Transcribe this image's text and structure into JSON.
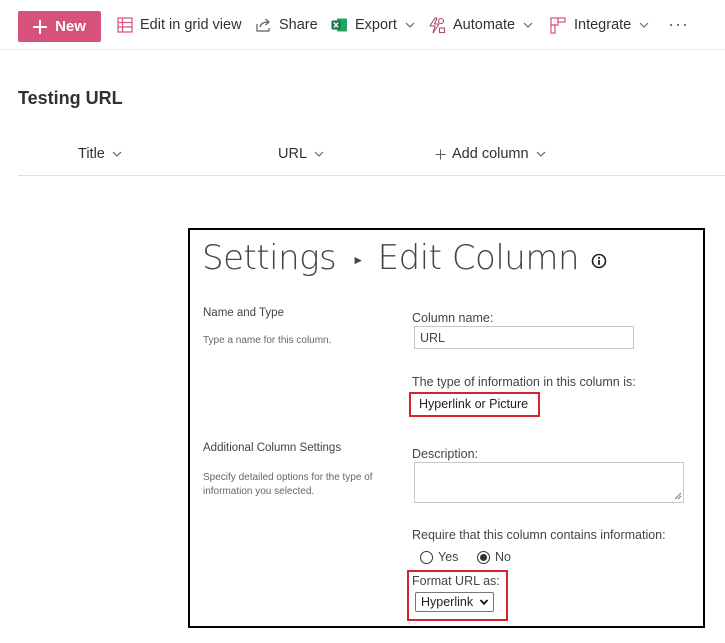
{
  "command_bar": {
    "new_label": "New",
    "edit_grid_label": "Edit in grid view",
    "share_label": "Share",
    "export_label": "Export",
    "automate_label": "Automate",
    "integrate_label": "Integrate",
    "more_label": "···"
  },
  "list": {
    "title": "Testing URL",
    "columns": [
      "Title",
      "URL"
    ],
    "add_column_label": "Add column"
  },
  "settings": {
    "breadcrumb_root": "Settings",
    "breadcrumb_page": "Edit Column",
    "name_type_section": {
      "title": "Name and Type",
      "description": "Type a name for this column."
    },
    "column_name_label": "Column name:",
    "column_name_value": "URL",
    "type_label": "The type of information in this column is:",
    "type_value": "Hyperlink or Picture",
    "additional_section": {
      "title": "Additional Column Settings",
      "description": "Specify detailed options for the type of information you selected."
    },
    "description_label": "Description:",
    "description_value": "",
    "required_label": "Require that this column contains information:",
    "required_options": [
      "Yes",
      "No"
    ],
    "required_selected": "No",
    "format_label": "Format URL as:",
    "format_value": "Hyperlink"
  },
  "colors": {
    "accent": "#d6527a",
    "highlight": "#d6242c",
    "excel_green": "#1d7044",
    "automate_icon": "#b04a6c"
  },
  "icons": [
    "plus-icon",
    "grid-icon",
    "share-icon",
    "excel-icon",
    "automate-icon",
    "integrate-icon",
    "chevron-down-icon",
    "info-icon",
    "resize-grip-icon"
  ]
}
